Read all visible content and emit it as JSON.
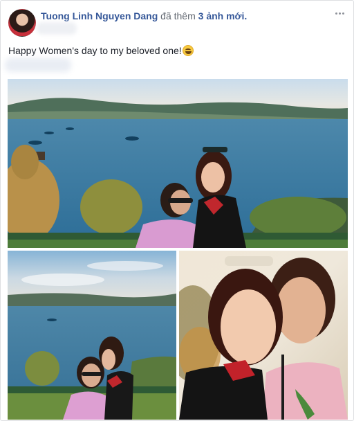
{
  "post": {
    "author": "Tuong Linh Nguyen Dang",
    "action_prefix": "đã thêm",
    "action_count": "3 ảnh mới.",
    "text": "Happy Women's day to my beloved one!",
    "emoji_icon": "laughing-emoji-icon",
    "more_icon": "ellipsis-icon"
  },
  "photos": [
    {
      "name": "photo-1",
      "subject": "two women by the sea"
    },
    {
      "name": "photo-2",
      "subject": "kiss on cheek by the sea"
    },
    {
      "name": "photo-3",
      "subject": "close-up selfie"
    }
  ],
  "colors": {
    "link": "#365899",
    "text": "#1d2129",
    "muted": "#616770",
    "border": "#dddfe2"
  }
}
